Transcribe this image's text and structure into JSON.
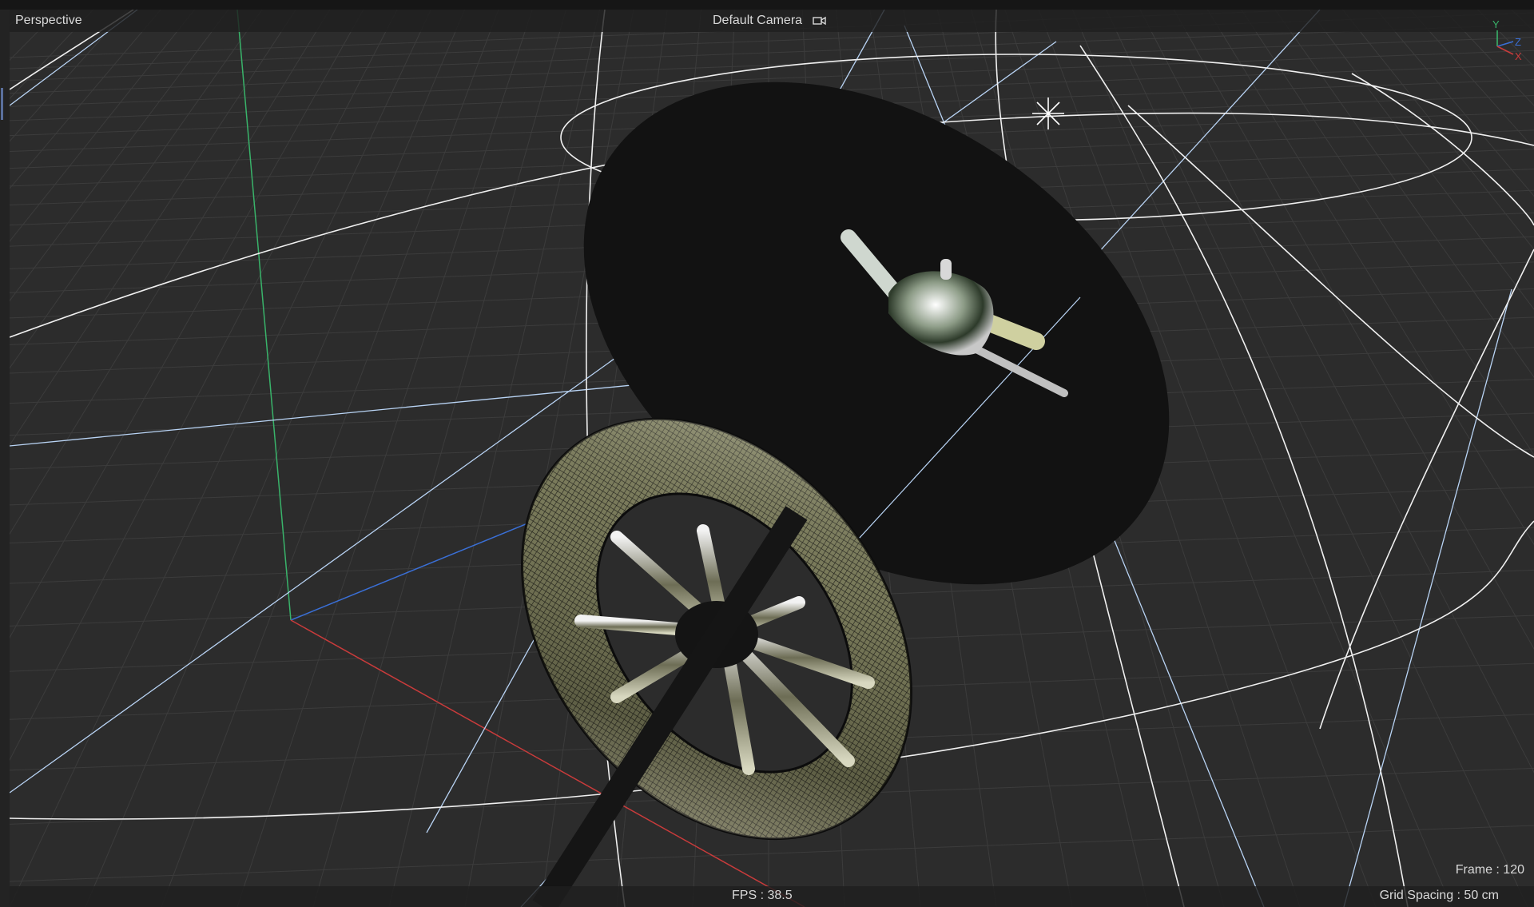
{
  "viewport": {
    "view_name": "Perspective",
    "camera_name": "Default Camera",
    "camera_icon": "camera-icon",
    "fps_label": "FPS : 38.5",
    "frame_label": "Frame : 120",
    "grid_spacing_label": "Grid Spacing : 50 cm"
  },
  "axis_gizmo": {
    "y_label": "Y",
    "z_label": "Z",
    "x_label": "X"
  },
  "colors": {
    "background": "#2c2c2c",
    "grid_line": "#3a3a3a",
    "axis_x": "#c93b3b",
    "axis_y": "#39b36a",
    "axis_z": "#3a6fd6",
    "wire_white": "#f0f0f0",
    "wire_light_blue": "#b9d4f5",
    "disc": "#121212",
    "light_icon": "#ffffff"
  },
  "scene_objects": [
    "light-source-icon",
    "black-disc",
    "torus-wheel",
    "chrome-duck",
    "ground-grid"
  ]
}
